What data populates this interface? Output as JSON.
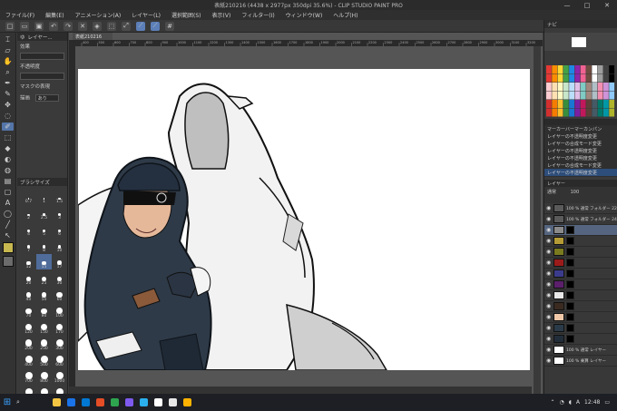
{
  "window": {
    "title": "表紙210216 (4438 x 2977px 350dpi 35.6%) - CLIP STUDIO PAINT PRO",
    "controls": [
      "—",
      "□",
      "✕"
    ]
  },
  "menu": [
    "ファイル(F)",
    "編集(E)",
    "アニメーション(A)",
    "レイヤー(L)",
    "選択範囲(S)",
    "表示(V)",
    "フィルター(I)",
    "ウィンドウ(W)",
    "ヘルプ(H)"
  ],
  "command_icons": [
    "new-icon",
    "open-icon",
    "save-icon",
    "undo-icon",
    "redo-icon",
    "clear-icon",
    "fill-icon",
    "select-icon",
    "transform-icon",
    "snap-icon",
    "ruler-icon",
    "grid-icon"
  ],
  "tools": {
    "icons": [
      "eyedrop-icon",
      "eraser-icon",
      "hand-icon",
      "zoom-icon",
      "pen-icon",
      "pencil-icon",
      "brush-icon",
      "move-icon",
      "lasso-icon",
      "select-icon",
      "bucket-icon",
      "gradient-icon",
      "blend-icon",
      "blur-icon",
      "figure-icon",
      "text-icon",
      "balloon-icon",
      "line-icon",
      "ruler-icon",
      "operation-icon"
    ],
    "main_color": "#c8b850",
    "sub_color": "#6b6b6b"
  },
  "subtool_panel": {
    "tabs": [
      "ゆ",
      "レイヤー..."
    ],
    "label1": "効果",
    "label2": "不透明度",
    "label3": "マスクの表現",
    "label4": "描画",
    "drop_value": "あり"
  },
  "brush_size": {
    "header": "ブラシサイズ",
    "sizes": [
      "0.7",
      "1",
      "1.5",
      "2",
      "2.5",
      "3",
      "4",
      "5",
      "6",
      "7",
      "8",
      "10",
      "12",
      "15",
      "17",
      "20",
      "25",
      "30",
      "40",
      "50",
      "60",
      "70",
      "80",
      "100",
      "120",
      "150",
      "170",
      "200",
      "250",
      "300",
      "400",
      "500",
      "600",
      "700",
      "800",
      "1000",
      "1200",
      "1500",
      "1700"
    ],
    "selected": "15"
  },
  "canvas": {
    "doc_tab": "表紙210216",
    "ruler_marks": [
      "400",
      "500",
      "600",
      "700",
      "800",
      "900",
      "1000",
      "1100",
      "1200",
      "1300",
      "1400",
      "1500",
      "1600",
      "1700",
      "1800",
      "1900",
      "2000",
      "2100",
      "2200",
      "2300",
      "2400",
      "2500",
      "2600",
      "2700",
      "2800",
      "2900",
      "3000",
      "3100",
      "3200"
    ],
    "zoom": "35.6"
  },
  "navigator": {
    "label": "ナビ"
  },
  "colors": {
    "swatches": [
      "#e53935",
      "#fb8c00",
      "#fdd835",
      "#43a047",
      "#1e88e5",
      "#8e24aa",
      "#f06292",
      "#6d4c41",
      "#ffffff",
      "#9e9e9e",
      "#424242",
      "#000000",
      "#ffcdd2",
      "#ffe0b2",
      "#fff9c4",
      "#c8e6c9",
      "#bbdefb",
      "#e1bee7",
      "#80cbc4",
      "#a1887f",
      "#b0bec5",
      "#f48fb1",
      "#ce93d8",
      "#90caf9",
      "#d32f2f",
      "#f57c00",
      "#fbc02d",
      "#388e3c",
      "#1976d2",
      "#7b1fa2",
      "#c2185b",
      "#5d4037",
      "#455a64",
      "#00796b",
      "#0097a7",
      "#afb42b"
    ]
  },
  "history": {
    "items": [
      "マーカーバーマーカンパン",
      "レイヤーの不透明度変更",
      "レイヤーの合成モード変更",
      "レイヤーの不透明度変更",
      "レイヤーの不透明度変更",
      "レイヤーの合成モード変更",
      "レイヤーの不透明度変更"
    ]
  },
  "layers": {
    "header": "レイヤー",
    "blend": "通常",
    "opacity": "100",
    "rows": [
      {
        "name": "100 % 通常 フォルダー 22",
        "color": "#5a5a5a",
        "mask": false
      },
      {
        "name": "100 % 通常 フォルダー 24",
        "color": "#5a5a5a",
        "mask": false
      },
      {
        "name": "",
        "color": "#8a8a8a",
        "mask": true
      },
      {
        "name": "",
        "color": "#b59b35",
        "mask": true
      },
      {
        "name": "",
        "color": "#7a7a1f",
        "mask": true
      },
      {
        "name": "",
        "color": "#9b1b1b",
        "mask": true
      },
      {
        "name": "",
        "color": "#3b3b8c",
        "mask": true
      },
      {
        "name": "",
        "color": "#5b1f6b",
        "mask": true
      },
      {
        "name": "",
        "color": "#e8e8e8",
        "mask": true
      },
      {
        "name": "",
        "color": "#3a2a20",
        "mask": true
      },
      {
        "name": "",
        "color": "#f0c8a8",
        "mask": true
      },
      {
        "name": "",
        "color": "#2a3a48",
        "mask": true
      },
      {
        "name": "",
        "color": "#222d3a",
        "mask": true
      },
      {
        "name": "100 % 通常 レイヤー",
        "color": "#ffffff",
        "mask": false
      },
      {
        "name": "100 % 乗算 レイヤー",
        "color": "#ffffff",
        "mask": false
      }
    ]
  },
  "taskbar": {
    "apps": [
      "#f4c542",
      "#1a73e8",
      "#0078d4",
      "#e44d26",
      "#2ea44f",
      "#7f5af0",
      "#2bb0ed",
      "#ffffff",
      "#e8e8e8",
      "#ffb300"
    ],
    "time": "12:48",
    "lang": "A"
  }
}
